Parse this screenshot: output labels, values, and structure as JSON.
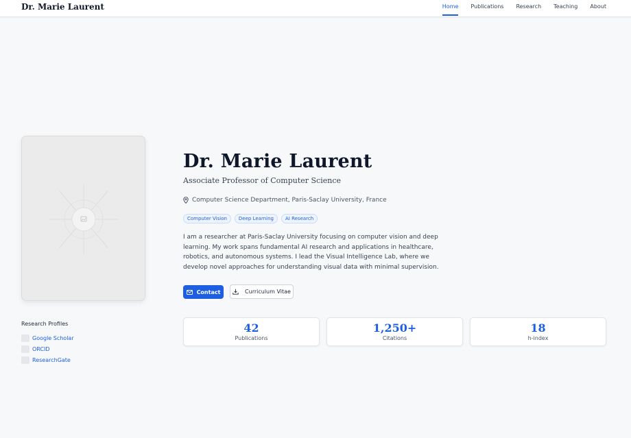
{
  "header": {
    "site_title": "Dr. Marie Laurent",
    "nav": [
      {
        "label": "Home",
        "active": true
      },
      {
        "label": "Publications",
        "active": false
      },
      {
        "label": "Research",
        "active": false
      },
      {
        "label": "Teaching",
        "active": false
      },
      {
        "label": "About",
        "active": false
      }
    ]
  },
  "profile": {
    "name": "Dr. Marie Laurent",
    "title": "Associate Professor of Computer Science",
    "location": "Computer Science Department, Paris-Saclay University, France",
    "location_icon": "map-pin-icon",
    "tags": [
      "Computer Vision",
      "Deep Learning",
      "AI Research"
    ],
    "bio": "I am a researcher at Paris-Saclay University focusing on computer vision and deep learning. My work spans fundamental AI research and applications in healthcare, robotics, and autonomous systems. I lead the Visual Intelligence Lab, where we develop novel approaches for understanding visual data with minimal supervision."
  },
  "actions": {
    "contact_label": "Contact",
    "contact_icon": "mail-icon",
    "cv_label": "Curriculum Vitae",
    "cv_icon": "download-icon"
  },
  "research_profiles": {
    "title": "Research Profiles",
    "links": [
      "Google Scholar",
      "ORCID",
      "ResearchGate"
    ]
  },
  "stats": [
    {
      "value": "42",
      "label": "Publications"
    },
    {
      "value": "1,250+",
      "label": "Citations"
    },
    {
      "value": "18",
      "label": "h-index"
    }
  ],
  "colors": {
    "accent": "#1d5fe0",
    "background": "#f7f8fa",
    "text": "#0f172a"
  }
}
